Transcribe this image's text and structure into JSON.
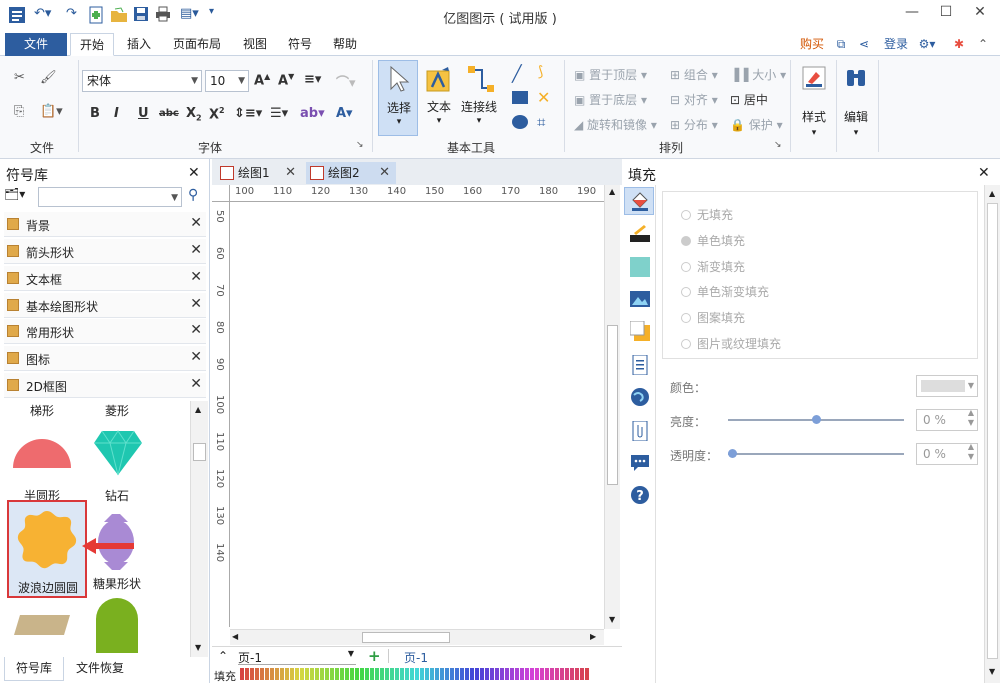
{
  "title": "亿图图示 ( 试用版 )",
  "menu": {
    "file": "文件",
    "tabs": [
      "开始",
      "插入",
      "页面布局",
      "视图",
      "符号",
      "帮助"
    ],
    "right": {
      "buy": "购买",
      "login": "登录"
    }
  },
  "ribbon": {
    "font_name": "宋体",
    "font_size": "10",
    "group_file": "文件",
    "group_font": "字体",
    "group_basic": "基本工具",
    "group_arrange": "排列",
    "select_label": "选择",
    "text_label": "文本",
    "connector_label": "连接线",
    "style_label": "样式",
    "edit_label": "编辑",
    "arrange": {
      "bring_front": "置于顶层",
      "send_back": "置于底层",
      "rotate": "旋转和镜像",
      "group": "组合",
      "align": "对齐",
      "distribute": "分布",
      "size": "大小",
      "center": "居中",
      "protect": "保护"
    }
  },
  "left_panel": {
    "title": "符号库",
    "libraries": [
      "背景",
      "箭头形状",
      "文本框",
      "基本绘图形状",
      "常用形状",
      "图标",
      "2D框图"
    ],
    "shapes": [
      "梯形",
      "菱形",
      "半圆形",
      "钻石",
      "波浪边圆圆",
      "糖果形状"
    ],
    "bottom_tabs": [
      "符号库",
      "文件恢复"
    ]
  },
  "doc_tabs": [
    "绘图1",
    "绘图2"
  ],
  "ruler_top": [
    "100",
    "110",
    "120",
    "130",
    "140",
    "150",
    "160",
    "170",
    "180",
    "190"
  ],
  "ruler_left": [
    "50",
    "60",
    "70",
    "80",
    "90",
    "100",
    "110",
    "120",
    "130",
    "140"
  ],
  "page_bar": {
    "page_select": "页-1",
    "page_tab": "页-1",
    "fill_label": "填充"
  },
  "right_panel": {
    "title": "填充",
    "options": [
      "无填充",
      "单色填充",
      "渐变填充",
      "单色渐变填充",
      "图案填充",
      "图片或纹理填充"
    ],
    "color_label": "颜色：",
    "brightness_label": "亮度：",
    "brightness_value": "0 %",
    "transparency_label": "透明度：",
    "transparency_value": "0 %"
  },
  "colors": {
    "accent": "#2d5d9f",
    "shape_red": "#ee6b6e",
    "shape_teal": "#1fc7b0",
    "shape_orange": "#f7b233",
    "shape_purple": "#a98ad4",
    "highlight": "#e53935"
  }
}
